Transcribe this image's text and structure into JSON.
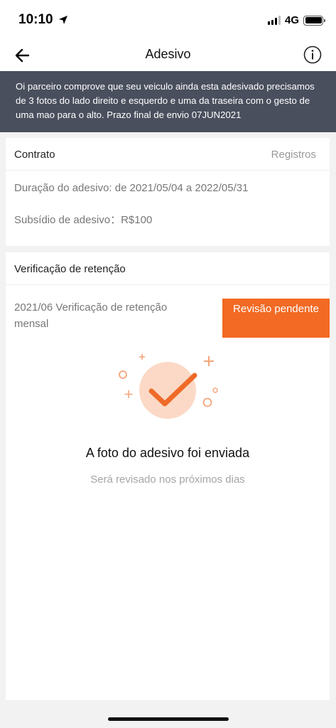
{
  "status_bar": {
    "time": "10:10",
    "network": "4G",
    "battery_level": 1.0
  },
  "nav": {
    "title": "Adesivo",
    "back_icon": "arrow-left-icon",
    "info_icon": "info-circle-icon"
  },
  "banner": {
    "text": "Oi parceiro comprove que seu veiculo ainda esta adesivado precisamos de 3 fotos do lado direito e esquerdo e uma da traseira com o gesto de uma mao para o alto. Prazo final de envio 07JUN2021"
  },
  "contract": {
    "title": "Contrato",
    "records_link": "Registros",
    "duration": "Duração do adesivo: de 2021/05/04 a 2022/05/31",
    "subsidy": "Subsídio de adesivo：R$100"
  },
  "retention": {
    "title": "Verificação de retenção",
    "item_label": "2021/06 Verificação de retenção mensal",
    "status": "Revisão pendente",
    "status_color": "#f26a24",
    "success_title": "A foto do adesivo foi enviada",
    "success_subtitle": "Será revisado nos próximos dias",
    "illustration_icon": "check-circle-icon"
  },
  "colors": {
    "accent": "#f26a24",
    "banner_bg": "#4a4f5e"
  }
}
